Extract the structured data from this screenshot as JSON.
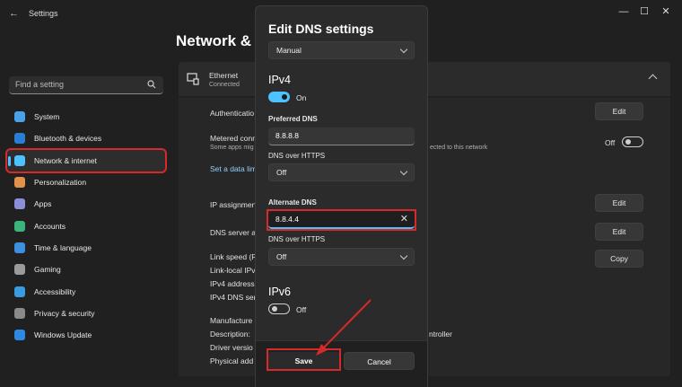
{
  "window": {
    "back": "←",
    "title": "Settings",
    "minimize": "—",
    "maximize": "☐",
    "close": "✕"
  },
  "sidebar": {
    "search_placeholder": "Find a setting",
    "items": [
      {
        "label": "System",
        "color": "#4aa3e8"
      },
      {
        "label": "Bluetooth & devices",
        "color": "#2a7fd4"
      },
      {
        "label": "Network & internet",
        "color": "#4cc2ff"
      },
      {
        "label": "Personalization",
        "color": "#e3904a"
      },
      {
        "label": "Apps",
        "color": "#8a8fd8"
      },
      {
        "label": "Accounts",
        "color": "#3bb37a"
      },
      {
        "label": "Time & language",
        "color": "#3d8fe0"
      },
      {
        "label": "Gaming",
        "color": "#9a9a9a"
      },
      {
        "label": "Accessibility",
        "color": "#3b9be0"
      },
      {
        "label": "Privacy & security",
        "color": "#8a8a8a"
      },
      {
        "label": "Windows Update",
        "color": "#2f89e0"
      }
    ]
  },
  "main": {
    "page_title": "Network &",
    "ethernet": {
      "label": "Ethernet",
      "status": "Connected"
    },
    "rows": {
      "authentication": "Authenticatio",
      "metered": "Metered conn",
      "metered_desc": "Some apps mig",
      "metered_desc_right": "ected to this network",
      "metered_toggle": "Off",
      "data_limit": "Set a data lim",
      "ip_assignment": "IP assignmen",
      "dns_server": "DNS server a",
      "link_speed": "Link speed (R",
      "link_local": "Link-local IPv",
      "ipv4_address": "IPv4 address:",
      "ipv4_dns": "IPv4 DNS ser",
      "manufacturer": "Manufacture",
      "description": "Description:",
      "description_right": "ntroller",
      "driver_version": "Driver versio",
      "physical": "Physical add"
    },
    "buttons": {
      "edit1": "Edit",
      "edit2": "Edit",
      "edit3": "Edit",
      "copy": "Copy"
    }
  },
  "dialog": {
    "title": "Edit DNS settings",
    "mode": "Manual",
    "ipv4": {
      "heading": "IPv4",
      "toggle_label": "On",
      "preferred_label": "Preferred DNS",
      "preferred_value": "8.8.8.8",
      "https1_label": "DNS over HTTPS",
      "https1_value": "Off",
      "alternate_label": "Alternate DNS",
      "alternate_value": "8.8.4.4",
      "https2_label": "DNS over HTTPS",
      "https2_value": "Off"
    },
    "ipv6": {
      "heading": "IPv6",
      "toggle_label": "Off"
    },
    "save": "Save",
    "cancel": "Cancel"
  },
  "colors": {
    "accent": "#4cc2ff",
    "highlight": "#d52a2a"
  }
}
